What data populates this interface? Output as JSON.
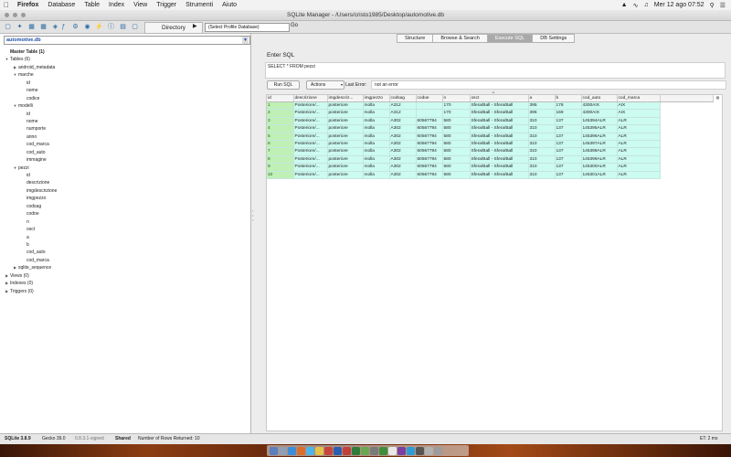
{
  "menubar": {
    "app": "Firefox",
    "items": [
      "Database",
      "Table",
      "Index",
      "View",
      "Trigger",
      "Strumenti",
      "Aiuto"
    ],
    "clock": "Mer 12 ago  07:52"
  },
  "window": {
    "title": "SQLite Manager - /Users/cristo1985/Desktop/automotive.db"
  },
  "toolbar": {
    "directory_label": "Directory",
    "profile_select": "(Select Profile Database)",
    "go_label": "Go"
  },
  "left": {
    "db_select": "automotive.db",
    "tree": [
      {
        "label": "Master Table (1)",
        "level": 0,
        "toggle": "",
        "bold": true
      },
      {
        "label": "Tables (6)",
        "level": 0,
        "toggle": "▼"
      },
      {
        "label": "android_metadata",
        "level": 1,
        "toggle": "▶"
      },
      {
        "label": "marche",
        "level": 1,
        "toggle": "▼"
      },
      {
        "label": "id",
        "level": 2,
        "toggle": ""
      },
      {
        "label": "nome",
        "level": 2,
        "toggle": ""
      },
      {
        "label": "codice",
        "level": 2,
        "toggle": ""
      },
      {
        "label": "modelli",
        "level": 1,
        "toggle": "▼"
      },
      {
        "label": "id",
        "level": 2,
        "toggle": ""
      },
      {
        "label": "nome",
        "level": 2,
        "toggle": ""
      },
      {
        "label": "numporte",
        "level": 2,
        "toggle": ""
      },
      {
        "label": "anno",
        "level": 2,
        "toggle": ""
      },
      {
        "label": "cod_marca",
        "level": 2,
        "toggle": ""
      },
      {
        "label": "cod_auto",
        "level": 2,
        "toggle": ""
      },
      {
        "label": "immagine",
        "level": 2,
        "toggle": ""
      },
      {
        "label": "pezzi",
        "level": 1,
        "toggle": "▼"
      },
      {
        "label": "id",
        "level": 2,
        "toggle": ""
      },
      {
        "label": "descrizione",
        "level": 2,
        "toggle": ""
      },
      {
        "label": "imgdescrizione",
        "level": 2,
        "toggle": ""
      },
      {
        "label": "imgpezzo",
        "level": 2,
        "toggle": ""
      },
      {
        "label": "codsag",
        "level": 2,
        "toggle": ""
      },
      {
        "label": "codoe",
        "level": 2,
        "toggle": ""
      },
      {
        "label": "n",
        "level": 2,
        "toggle": ""
      },
      {
        "label": "osct",
        "level": 2,
        "toggle": ""
      },
      {
        "label": "a",
        "level": 2,
        "toggle": ""
      },
      {
        "label": "b",
        "level": 2,
        "toggle": ""
      },
      {
        "label": "cod_auto",
        "level": 2,
        "toggle": ""
      },
      {
        "label": "cod_marca",
        "level": 2,
        "toggle": ""
      },
      {
        "label": "sqlite_sequence",
        "level": 1,
        "toggle": "▶"
      },
      {
        "label": "Views (0)",
        "level": 0,
        "toggle": "▶"
      },
      {
        "label": "Indexes (0)",
        "level": 0,
        "toggle": "▶"
      },
      {
        "label": "Triggers (0)",
        "level": 0,
        "toggle": "▶"
      }
    ]
  },
  "tabs": [
    "Structure",
    "Browse & Search",
    "Execute SQL",
    "DB Settings"
  ],
  "active_tab": 2,
  "sql": {
    "enter_label": "Enter SQL",
    "query": "SELECT * FROM pezzi",
    "run_label": "Run SQL",
    "actions_label": "Actions",
    "last_error_label": "Last Error:",
    "last_error_value": "not an error"
  },
  "grid": {
    "columns": [
      "id",
      "descrizione",
      "imgdescriz...",
      "imgpezzo",
      "codsag",
      "codoe",
      "n",
      "osct",
      "a",
      "b",
      "cod_auto",
      "cod_marca"
    ],
    "rows": [
      [
        "1",
        "Posteriore/...",
        "posteriore",
        "molla",
        "A312",
        "",
        "170",
        "Sfera/Ball - Sfera/Ball",
        "395",
        "178",
        "4300AIX",
        "AIX"
      ],
      [
        "2",
        "Posteriore/...",
        "posteriore",
        "molla",
        "A312",
        "",
        "170",
        "Sfera/Ball - Sfera/Ball",
        "396",
        "169",
        "4300AIX",
        "AIX"
      ],
      [
        "3",
        "Posteriore/...",
        "posteriore",
        "molla",
        "A302",
        "60567794",
        "580",
        "Sfera/Ball - Sfera/Ball",
        "310",
        "137",
        "145394ALR",
        "ALR"
      ],
      [
        "4",
        "Posteriore/...",
        "posteriore",
        "molla",
        "A302",
        "60567794",
        "580",
        "Sfera/Ball - Sfera/Ball",
        "310",
        "137",
        "145395ALR",
        "ALR"
      ],
      [
        "5",
        "Posteriore/...",
        "posteriore",
        "molla",
        "A302",
        "60567794",
        "580",
        "Sfera/Ball - Sfera/Ball",
        "310",
        "137",
        "145396ALR",
        "ALR"
      ],
      [
        "6",
        "Posteriore/...",
        "posteriore",
        "molla",
        "A302",
        "60567794",
        "580",
        "Sfera/Ball - Sfera/Ball",
        "310",
        "137",
        "145397ALR",
        "ALR"
      ],
      [
        "7",
        "Posteriore/...",
        "posteriore",
        "molla",
        "A302",
        "60567794",
        "580",
        "Sfera/Ball - Sfera/Ball",
        "310",
        "137",
        "145398ALR",
        "ALR"
      ],
      [
        "8",
        "Posteriore/...",
        "posteriore",
        "molla",
        "A302",
        "60567794",
        "580",
        "Sfera/Ball - Sfera/Ball",
        "310",
        "137",
        "145399ALR",
        "ALR"
      ],
      [
        "9",
        "Posteriore/...",
        "posteriore",
        "molla",
        "A302",
        "60567794",
        "580",
        "Sfera/Ball - Sfera/Ball",
        "310",
        "137",
        "145300ALR",
        "ALR"
      ],
      [
        "10",
        "Posteriore/...",
        "posteriore",
        "molla",
        "A302",
        "60567794",
        "580",
        "Sfera/Ball - Sfera/Ball",
        "310",
        "137",
        "145301ALR",
        "ALR"
      ]
    ]
  },
  "status": {
    "version": "SQLite 3.8.9",
    "gecko": "Gecko 39.0",
    "signed": "0.8.3.1-signed",
    "shared": "Shared",
    "rows_returned": "Number of Rows Returned: 10",
    "elapsed": "ET: 2 ms"
  },
  "colors": {
    "row_bg": "#ccfbf0",
    "id_bg": "#bff0b6",
    "active_tab": "#a9a9a9",
    "link_blue": "#1d4fa6"
  }
}
